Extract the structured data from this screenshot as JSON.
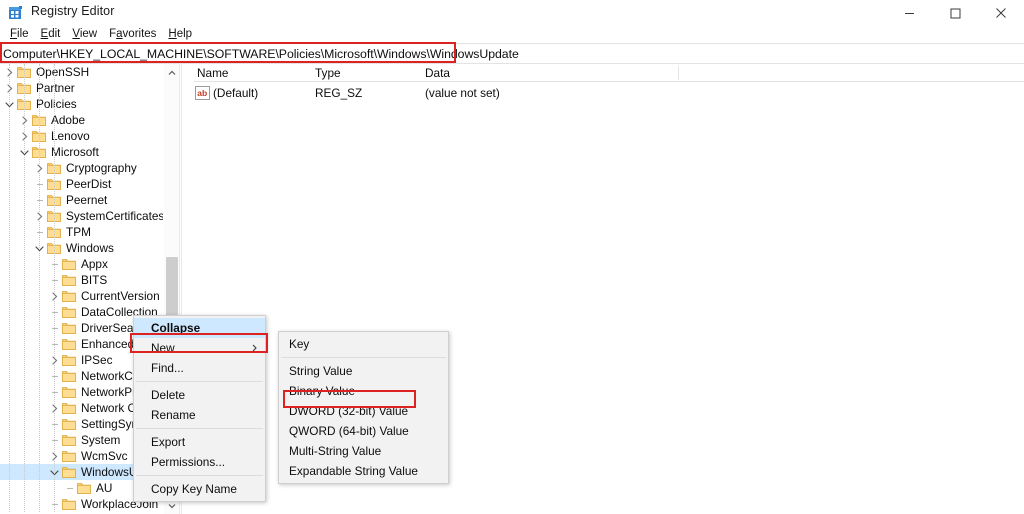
{
  "window": {
    "title": "Registry Editor",
    "app_icon": "registry-editor-icon",
    "controls": [
      {
        "name": "minimize-button",
        "glyph": "minimize"
      },
      {
        "name": "maximize-button",
        "glyph": "maximize"
      },
      {
        "name": "close-button",
        "glyph": "close"
      }
    ]
  },
  "menubar": {
    "items": [
      {
        "label": "File",
        "accel": "F"
      },
      {
        "label": "Edit",
        "accel": "E"
      },
      {
        "label": "View",
        "accel": "V"
      },
      {
        "label": "Favorites",
        "accel": "a"
      },
      {
        "label": "Help",
        "accel": "H"
      }
    ]
  },
  "address_bar": {
    "value": "Computer\\HKEY_LOCAL_MACHINE\\SOFTWARE\\Policies\\Microsoft\\Windows\\WindowsUpdate",
    "placeholder": "Computer\\"
  },
  "tree": {
    "items": [
      {
        "label": "OpenSSH",
        "depth": 1,
        "twisty": "collapsed",
        "selected": false
      },
      {
        "label": "Partner",
        "depth": 1,
        "twisty": "collapsed",
        "selected": false
      },
      {
        "label": "Policies",
        "depth": 1,
        "twisty": "expanded",
        "selected": false
      },
      {
        "label": "Adobe",
        "depth": 2,
        "twisty": "collapsed",
        "selected": false
      },
      {
        "label": "Lenovo",
        "depth": 2,
        "twisty": "collapsed",
        "selected": false
      },
      {
        "label": "Microsoft",
        "depth": 2,
        "twisty": "expanded",
        "selected": false
      },
      {
        "label": "Cryptography",
        "depth": 3,
        "twisty": "collapsed",
        "selected": false
      },
      {
        "label": "PeerDist",
        "depth": 3,
        "twisty": "leaf",
        "selected": false
      },
      {
        "label": "Peernet",
        "depth": 3,
        "twisty": "leaf",
        "selected": false
      },
      {
        "label": "SystemCertificates",
        "depth": 3,
        "twisty": "collapsed",
        "selected": false
      },
      {
        "label": "TPM",
        "depth": 3,
        "twisty": "leaf",
        "selected": false
      },
      {
        "label": "Windows",
        "depth": 3,
        "twisty": "expanded",
        "selected": false
      },
      {
        "label": "Appx",
        "depth": 4,
        "twisty": "leaf",
        "selected": false
      },
      {
        "label": "BITS",
        "depth": 4,
        "twisty": "leaf",
        "selected": false
      },
      {
        "label": "CurrentVersion",
        "depth": 4,
        "twisty": "collapsed",
        "selected": false
      },
      {
        "label": "DataCollection",
        "depth": 4,
        "twisty": "leaf",
        "selected": false
      },
      {
        "label": "DriverSearching",
        "depth": 4,
        "twisty": "leaf",
        "selected": false
      },
      {
        "label": "EnhancedStorageDevices",
        "depth": 4,
        "twisty": "leaf",
        "selected": false
      },
      {
        "label": "IPSec",
        "depth": 4,
        "twisty": "collapsed",
        "selected": false
      },
      {
        "label": "NetworkConnections",
        "depth": 4,
        "twisty": "leaf",
        "selected": false
      },
      {
        "label": "NetworkProvider",
        "depth": 4,
        "twisty": "leaf",
        "selected": false
      },
      {
        "label": "Network Connectivity",
        "depth": 4,
        "twisty": "collapsed",
        "selected": false
      },
      {
        "label": "SettingSync",
        "depth": 4,
        "twisty": "leaf",
        "selected": false
      },
      {
        "label": "System",
        "depth": 4,
        "twisty": "leaf",
        "selected": false
      },
      {
        "label": "WcmSvc",
        "depth": 4,
        "twisty": "collapsed",
        "selected": false
      },
      {
        "label": "WindowsUpdate",
        "depth": 4,
        "twisty": "expanded",
        "selected": true
      },
      {
        "label": "AU",
        "depth": 5,
        "twisty": "leaf",
        "selected": false
      },
      {
        "label": "WorkplaceJoin",
        "depth": 4,
        "twisty": "leaf",
        "selected": false
      }
    ],
    "scrollbar": {
      "up_arrow": "chevron-up-icon",
      "down_arrow": "chevron-down-icon"
    }
  },
  "list_view": {
    "columns": [
      "Name",
      "Type",
      "Data"
    ],
    "rows": [
      {
        "icon": "string-value-icon",
        "name": "(Default)",
        "type": "REG_SZ",
        "data": "(value not set)"
      }
    ]
  },
  "context_menu": {
    "items": [
      {
        "label": "Collapse",
        "highlighted": true,
        "submenu": false,
        "separator_after": false
      },
      {
        "label": "New",
        "highlighted": false,
        "submenu": true,
        "separator_after": false
      },
      {
        "label": "Find...",
        "highlighted": false,
        "submenu": false,
        "separator_after": true
      },
      {
        "label": "Delete",
        "highlighted": false,
        "submenu": false,
        "separator_after": false
      },
      {
        "label": "Rename",
        "highlighted": false,
        "submenu": false,
        "separator_after": true
      },
      {
        "label": "Export",
        "highlighted": false,
        "submenu": false,
        "separator_after": false
      },
      {
        "label": "Permissions...",
        "highlighted": false,
        "submenu": false,
        "separator_after": true
      },
      {
        "label": "Copy Key Name",
        "highlighted": false,
        "submenu": false,
        "separator_after": false
      }
    ],
    "submenu_arrow": "chevron-right-icon"
  },
  "new_submenu": {
    "items": [
      {
        "label": "Key",
        "separator_after": true
      },
      {
        "label": "String Value",
        "separator_after": false
      },
      {
        "label": "Binary Value",
        "separator_after": false
      },
      {
        "label": "DWORD (32-bit) Value",
        "separator_after": false
      },
      {
        "label": "QWORD (64-bit) Value",
        "separator_after": false
      },
      {
        "label": "Multi-String Value",
        "separator_after": false
      },
      {
        "label": "Expandable String Value",
        "separator_after": false
      }
    ]
  },
  "annotations": {
    "highlight_color": "#dd2222",
    "boxes": [
      {
        "name": "address-bar-highlight",
        "target": "address_bar"
      },
      {
        "name": "new-menu-highlight",
        "target": "context_menu.New"
      },
      {
        "name": "dword-highlight",
        "target": "new_submenu.DWORD (32-bit) Value"
      }
    ]
  },
  "colors": {
    "selection": "#cde8ff",
    "folder": "#ffd37a",
    "accent": "#0078d7"
  }
}
